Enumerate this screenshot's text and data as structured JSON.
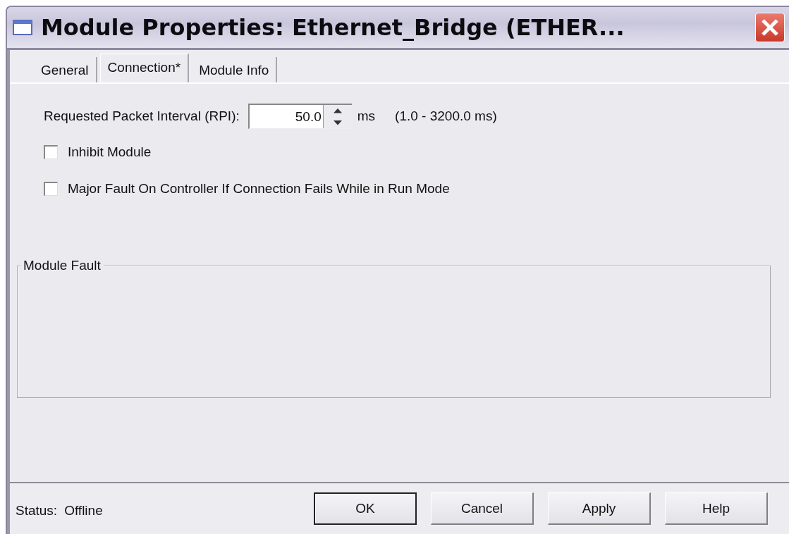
{
  "window": {
    "title": "Module Properties: Ethernet_Bridge (ETHER..."
  },
  "tabs": [
    {
      "label": "General",
      "selected": false
    },
    {
      "label": "Connection*",
      "selected": true
    },
    {
      "label": "Module Info",
      "selected": false
    }
  ],
  "rpi": {
    "label": "Requested Packet Interval (RPI):",
    "value": "50.0",
    "unit": "ms",
    "range": "(1.0 - 3200.0 ms)"
  },
  "options": [
    {
      "label": "Inhibit Module",
      "checked": false
    },
    {
      "label": "Major Fault On Controller If Connection Fails While in Run Mode",
      "checked": false
    }
  ],
  "module_fault": {
    "title": "Module Fault"
  },
  "status_bar": {
    "label": "Status:",
    "value": "Offline"
  },
  "buttons": [
    {
      "label": "OK",
      "default": true
    },
    {
      "label": "Cancel",
      "default": false
    },
    {
      "label": "Apply",
      "default": false
    },
    {
      "label": "Help",
      "default": false
    }
  ]
}
